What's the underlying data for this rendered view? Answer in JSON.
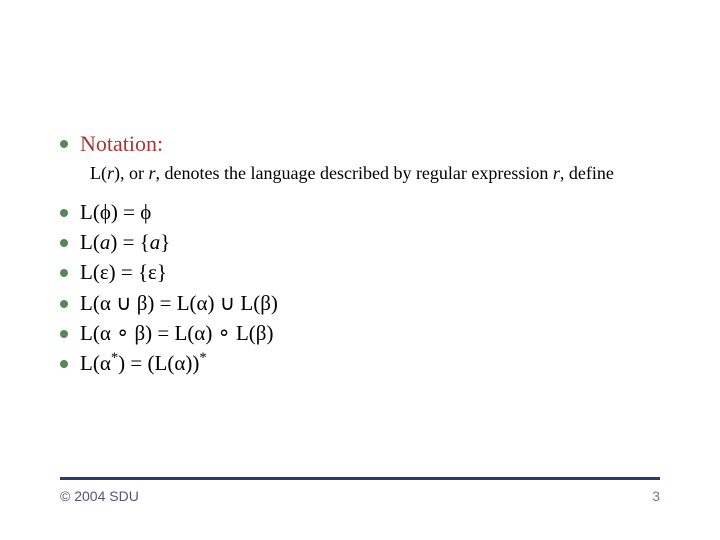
{
  "content": {
    "notation_label": "Notation:",
    "notation_sub_pre": "L(",
    "notation_sub_r1": "r",
    "notation_sub_mid1": "), or ",
    "notation_sub_r2": "r",
    "notation_sub_mid2": ", denotes the language described by regular expression ",
    "notation_sub_r3": "r",
    "notation_sub_tail": ", define",
    "f1": "L(ϕ) = ϕ",
    "f2_pre": "L(",
    "f2_a1": "a",
    "f2_mid": ") = {",
    "f2_a2": "a",
    "f2_post": "}",
    "f3": "L(ε) = {ε}",
    "f4": "L(α ∪ β) = L(α) ∪ L(β)",
    "f5": "L(α ∘ β) = L(α) ∘ L(β)",
    "f6_pre": "L(α",
    "f6_star1": "*",
    "f6_mid": ") = (L(α))",
    "f6_star2": "*"
  },
  "footer": {
    "copyright": "© 2004 SDU",
    "page": "3"
  }
}
